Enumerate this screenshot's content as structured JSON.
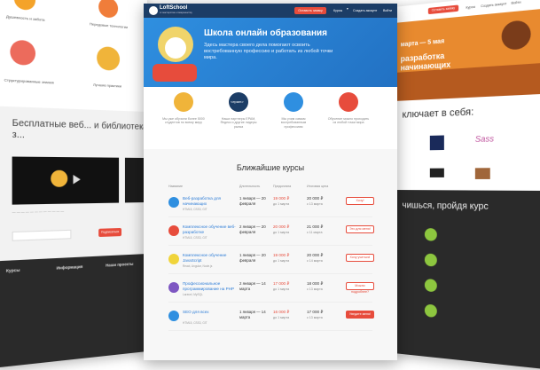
{
  "left": {
    "tile_labels": [
      "Душевность и забота",
      "Передовые технологии",
      "Структурированные знания",
      "Лучшие практики"
    ],
    "section_title": "Бесплатные веб... и библиотека з...",
    "footer_heading": "Курсы",
    "footer_info": "Информация",
    "footer_proj": "Наши проекты",
    "email_button": "Подписаться"
  },
  "center": {
    "logo": "LoftSchool",
    "logo_sub": "от мастерства к совершенству",
    "header_btn": "Оставить заявку",
    "menu_courses": "Курсы",
    "menu_create": "Создать аккаунт",
    "menu_login": "Войти",
    "hero_title": "Школа онлайн образования",
    "hero_subtitle": "Здесь мастера своего дела помогают освоить востребованную профессию и работать из любой точки мира.",
    "feature_captions": [
      "Мы уже обучили более 5000 студентов по всему миру",
      "Наши партнеры EPAM, Яндекс и другие лидеры рынка",
      "Мы учим самым востребованным профессиям",
      "Обучение можно проходить из любой точки мира"
    ],
    "epam_label": "<epam>",
    "courses_title": "Ближайшие курсы",
    "col_headers": [
      "Название",
      "Длительность",
      "Предоплата",
      "Итоговая цена"
    ],
    "courses": [
      {
        "name": "Веб-разработка для начинающих",
        "tags": "HTML5, CSS3, GIT",
        "dates": "1 января — 20 февраля",
        "price1": "19 000 ₽",
        "note1": "до 1 марта",
        "price2": "20 000 ₽",
        "note2": "с 13 марта",
        "action": "Хочу!"
      },
      {
        "name": "Комплексное обучение веб-разработке",
        "tags": "HTML5, CSS3, GIT",
        "dates": "2 января — 20 февраля",
        "price1": "20 000 ₽",
        "note1": "до 1 марта",
        "price2": "21 000 ₽",
        "note2": "с 11 марта",
        "action": "Это для меня!"
      },
      {
        "name": "Комплексное обучение JavaScript",
        "tags": "React, Angular, Node.js",
        "dates": "1 января — 20 февраля",
        "price1": "19 000 ₽",
        "note1": "до 1 марта",
        "price2": "20 000 ₽",
        "note2": "с 14 марта",
        "action": "Хочу учиться!"
      },
      {
        "name": "Профессиональное программирование на PHP",
        "tags": "Laravel, MySQL",
        "dates": "2 января — 14 марта",
        "price1": "17 000 ₽",
        "note1": "до 1 марта",
        "price2": "18 000 ₽",
        "note2": "с 13 марта",
        "action": "Можно подробнее?"
      },
      {
        "name": "SEO для всех",
        "tags": "HTML5, CSS3, GIT",
        "dates": "1 января — 14 марта",
        "price1": "16 000 ₽",
        "note1": "до 1 марта",
        "price2": "17 000 ₽",
        "note2": "с 13 марта",
        "action": "Уведите меня!"
      }
    ]
  },
  "right": {
    "menu_btn": "Оставить заявку",
    "menu_courses": "Курсы",
    "menu_create": "Создать аккаунт",
    "menu_login": "Войти",
    "hero_date": "марта — 5 мая",
    "hero_title": "разработка начинающих",
    "includes_title": "ключает в себя:",
    "learn_title": "чишься, пройдя курс"
  },
  "colors": {
    "accent": "#e74c3c",
    "hero_blue": "#2f8fe0",
    "dark": "#2a2a2a",
    "link": "#2b7bd6"
  }
}
